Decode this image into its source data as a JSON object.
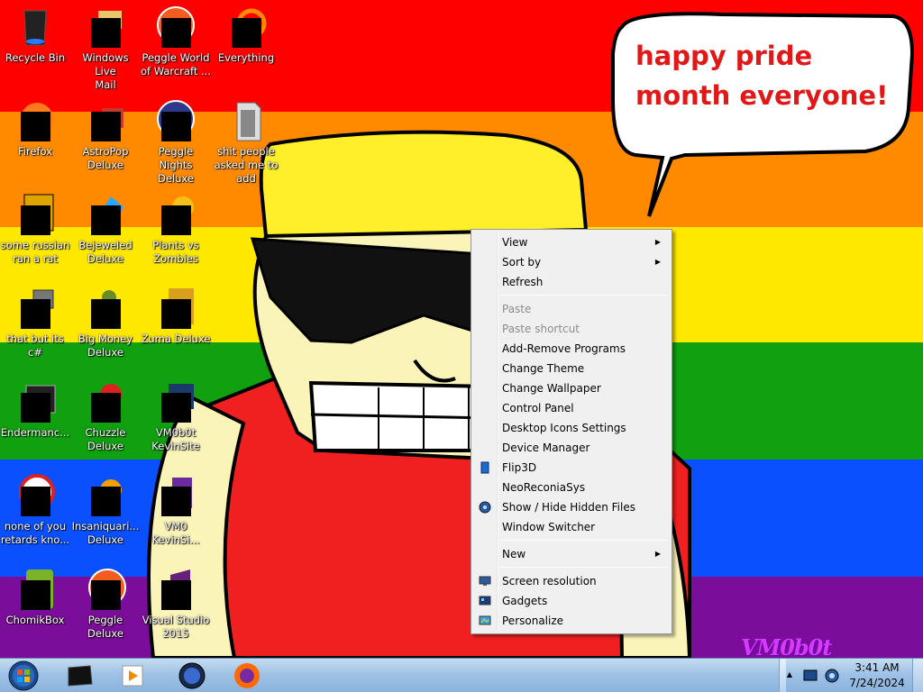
{
  "wallpaper": {
    "speech_bubble": "happy pride month everyone!",
    "signature": "VM0b0t"
  },
  "desktop_icons": [
    {
      "label": "Recycle Bin",
      "icon": "recycle-bin-icon"
    },
    {
      "label": "Windows Live\nMail",
      "icon": "windows-live-mail-icon"
    },
    {
      "label": "Peggle World\nof Warcraft ...",
      "icon": "peggle-world-of-warcraft-icon"
    },
    {
      "label": "Everything",
      "icon": "everything-search-icon"
    },
    {
      "label": "Firefox",
      "icon": "firefox-icon"
    },
    {
      "label": "AstroPop\nDeluxe",
      "icon": "astropop-deluxe-icon"
    },
    {
      "label": "Peggle Nights\nDeluxe",
      "icon": "peggle-nights-deluxe-icon"
    },
    {
      "label": "shit people\nasked me to\nadd",
      "icon": "folder-icon"
    },
    {
      "label": "some russian\nran a rat",
      "icon": "application-icon"
    },
    {
      "label": "Bejeweled\nDeluxe",
      "icon": "bejeweled-deluxe-icon"
    },
    {
      "label": "Plants vs\nZombies",
      "icon": "plants-vs-zombies-icon"
    },
    {
      "label": "that but its c#",
      "icon": "application-icon"
    },
    {
      "label": "Big Money\nDeluxe",
      "icon": "big-money-deluxe-icon"
    },
    {
      "label": "Zuma Deluxe",
      "icon": "zuma-deluxe-icon"
    },
    {
      "label": "Endermanc...",
      "icon": "terminal-icon"
    },
    {
      "label": "Chuzzle\nDeluxe",
      "icon": "chuzzle-deluxe-icon"
    },
    {
      "label": "VM0b0t\nKevinSite",
      "icon": "website-icon"
    },
    {
      "label": "none of you\nretards kno...",
      "icon": "application-icon"
    },
    {
      "label": "Insaniquari...\nDeluxe",
      "icon": "insaniquarium-deluxe-icon"
    },
    {
      "label": "VM0\nKevinSi...",
      "icon": "visual-studio-project-icon"
    },
    {
      "label": "ChomikBox",
      "icon": "chomikbox-icon"
    },
    {
      "label": "Peggle Deluxe",
      "icon": "peggle-deluxe-icon"
    },
    {
      "label": "Visual Studio\n2015",
      "icon": "visual-studio-icon"
    }
  ],
  "context_menu": {
    "group1": [
      {
        "label": "View",
        "submenu": true
      },
      {
        "label": "Sort by",
        "submenu": true
      },
      {
        "label": "Refresh"
      }
    ],
    "group2": [
      {
        "label": "Paste",
        "disabled": true
      },
      {
        "label": "Paste shortcut",
        "disabled": true
      },
      {
        "label": "Add-Remove Programs"
      },
      {
        "label": "Change Theme"
      },
      {
        "label": "Change Wallpaper"
      },
      {
        "label": "Control Panel"
      },
      {
        "label": "Desktop Icons Settings"
      },
      {
        "label": "Device Manager"
      },
      {
        "label": "Flip3D",
        "icon": "flip3d-icon"
      },
      {
        "label": "NeoReconiaSys"
      },
      {
        "label": "Show / Hide Hidden Files",
        "icon": "hidden-files-icon"
      },
      {
        "label": "Window Switcher"
      }
    ],
    "group3": [
      {
        "label": "New",
        "submenu": true
      }
    ],
    "group4": [
      {
        "label": "Screen resolution",
        "icon": "screen-resolution-icon"
      },
      {
        "label": "Gadgets",
        "icon": "gadgets-icon"
      },
      {
        "label": "Personalize",
        "icon": "personalize-icon"
      }
    ]
  },
  "taskbar": {
    "pinned": [
      {
        "name": "terminal",
        "icon": "terminal-app-icon"
      },
      {
        "name": "media-player",
        "icon": "windows-media-player-icon"
      },
      {
        "name": "globe",
        "icon": "globe-app-icon"
      },
      {
        "name": "firefox",
        "icon": "firefox-icon"
      }
    ],
    "clock": {
      "time": "3:41 AM",
      "date": "7/24/2024"
    }
  },
  "colors": {
    "stripe_red": "#ff0000",
    "stripe_orange": "#ff8a00",
    "stripe_yellow": "#ffe800",
    "stripe_green": "#10a010",
    "stripe_blue": "#0a50ff",
    "stripe_purple": "#7a0d9a",
    "speech_text": "#e01818"
  }
}
